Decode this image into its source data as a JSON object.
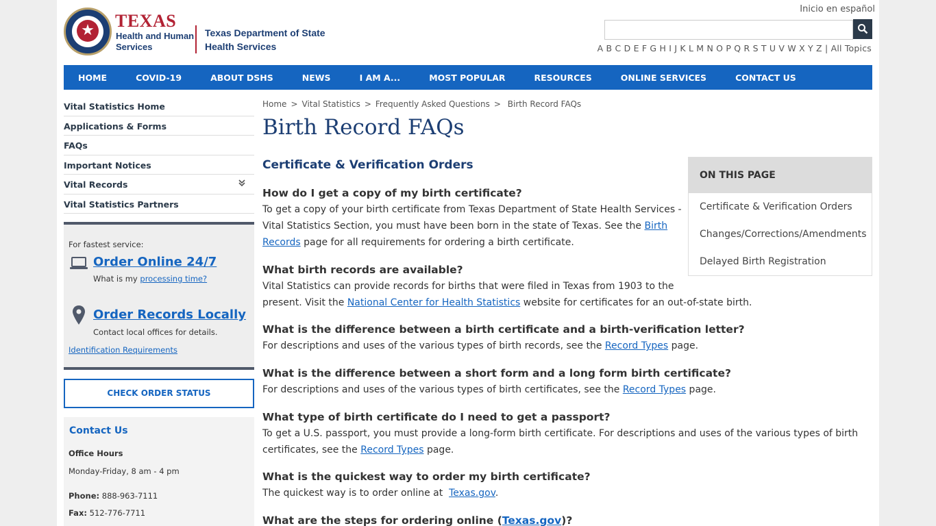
{
  "header": {
    "hhs_title": "TEXAS",
    "hhs_sub": "Health and Human Services",
    "dshs_name": "Texas Department of State Health Services",
    "lang_link": "Inicio en español",
    "search_placeholder": "",
    "az_letters": "A B C D E F G H I J K L M N O P Q R S T U V W X Y Z",
    "all_topics": "All Topics",
    "sep": "|"
  },
  "nav": [
    "HOME",
    "COVID-19",
    "ABOUT DSHS",
    "NEWS",
    "I AM A...",
    "MOST POPULAR",
    "RESOURCES",
    "ONLINE SERVICES",
    "CONTACT US"
  ],
  "sidenav": [
    "Vital Statistics Home",
    "Applications & Forms",
    "FAQs",
    "Important Notices",
    "Vital Records",
    "Vital Statistics Partners"
  ],
  "order": {
    "fastest": "For fastest service:",
    "online": "Order Online 24/7",
    "processing_prefix": "What is my ",
    "processing_link": "processing time?",
    "local": "Order Records Locally",
    "local_note": "Contact local offices for details.",
    "id_req": "Identification Requirements"
  },
  "check_status": "CHECK ORDER STATUS",
  "contact": {
    "title": "Contact Us",
    "hours_label": "Office Hours",
    "hours": "Monday-Friday, 8 am - 4 pm",
    "phone_label": "Phone:",
    "phone": "888-963-7111",
    "fax_label": "Fax:",
    "fax": "512-776-7711"
  },
  "breadcrumb": [
    "Home",
    "Vital Statistics",
    "Frequently Asked Questions",
    "Birth Record FAQs"
  ],
  "breadcrumb_sep": ">",
  "page_title": "Birth Record FAQs",
  "section_title": "Certificate & Verification Orders",
  "toc": {
    "heading": "ON THIS PAGE",
    "items": [
      "Certificate & Verification Orders",
      "Changes/Corrections/Amendments",
      "Delayed Birth Registration"
    ]
  },
  "faqs": [
    {
      "q": "How do I get a copy of my birth certificate?",
      "a1": "To get a copy of your birth certificate from Texas Department of State Health Services -",
      "a2": "Vital Statistics Section, you must have been born in the state of Texas. See the ",
      "link_a": "Birth",
      "link_b": "Records",
      "a3": " page for all requirements for ordering a birth certificate."
    },
    {
      "q": "What birth records are available?",
      "a1": "Vital Statistics can provide records for births that were filed in Texas from 1903 to the",
      "a2": "present. Visit the ",
      "link": "National Center for Health Statistics",
      "a3": " website for certificates for an out-of-state birth."
    },
    {
      "q": "What is the difference between a birth certificate and a birth-verification letter?",
      "a1": "For descriptions and uses of the various types of birth records, see the ",
      "link": "Record Types",
      "a2": " page."
    },
    {
      "q": "What is the difference between a short form and a long form birth certificate?",
      "a1": "For descriptions and uses of the various types of birth certificates, see the ",
      "link": "Record Types",
      "a2": " page."
    },
    {
      "q": "What type of birth certificate do I need to get a passport?",
      "a1": "To get a U.S. passport, you must provide a long-form birth certificate. For descriptions and uses of the various types of birth",
      "a2": "certificates, see the ",
      "link": "Record Types",
      "a3": " page."
    },
    {
      "q": "What is the quickest way to order my birth certificate?",
      "a1": "The quickest way is to order online at  ",
      "link": "Texas.gov",
      "a2": "."
    },
    {
      "q_prefix": "What are the steps for ordering online (",
      "q_link": "Texas.gov",
      "q_suffix": ")?"
    }
  ]
}
